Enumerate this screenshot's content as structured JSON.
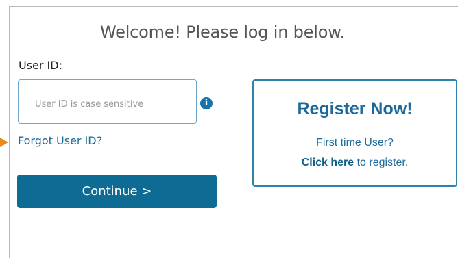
{
  "header": {
    "title": "Welcome! Please log in below."
  },
  "login": {
    "user_id_label": "User ID:",
    "user_id_value": "",
    "user_id_placeholder": "User ID is case sensitive",
    "info_icon": "info-icon",
    "forgot_link": "Forgot User ID?",
    "continue_label": "Continue >"
  },
  "register": {
    "title": "Register Now!",
    "first_time": "First time User?",
    "click_here": "Click here",
    "to_register": " to register."
  },
  "colors": {
    "primary_blue": "#0e6b93",
    "link_blue": "#1d6a9a",
    "arrow_orange": "#e88a1f"
  }
}
